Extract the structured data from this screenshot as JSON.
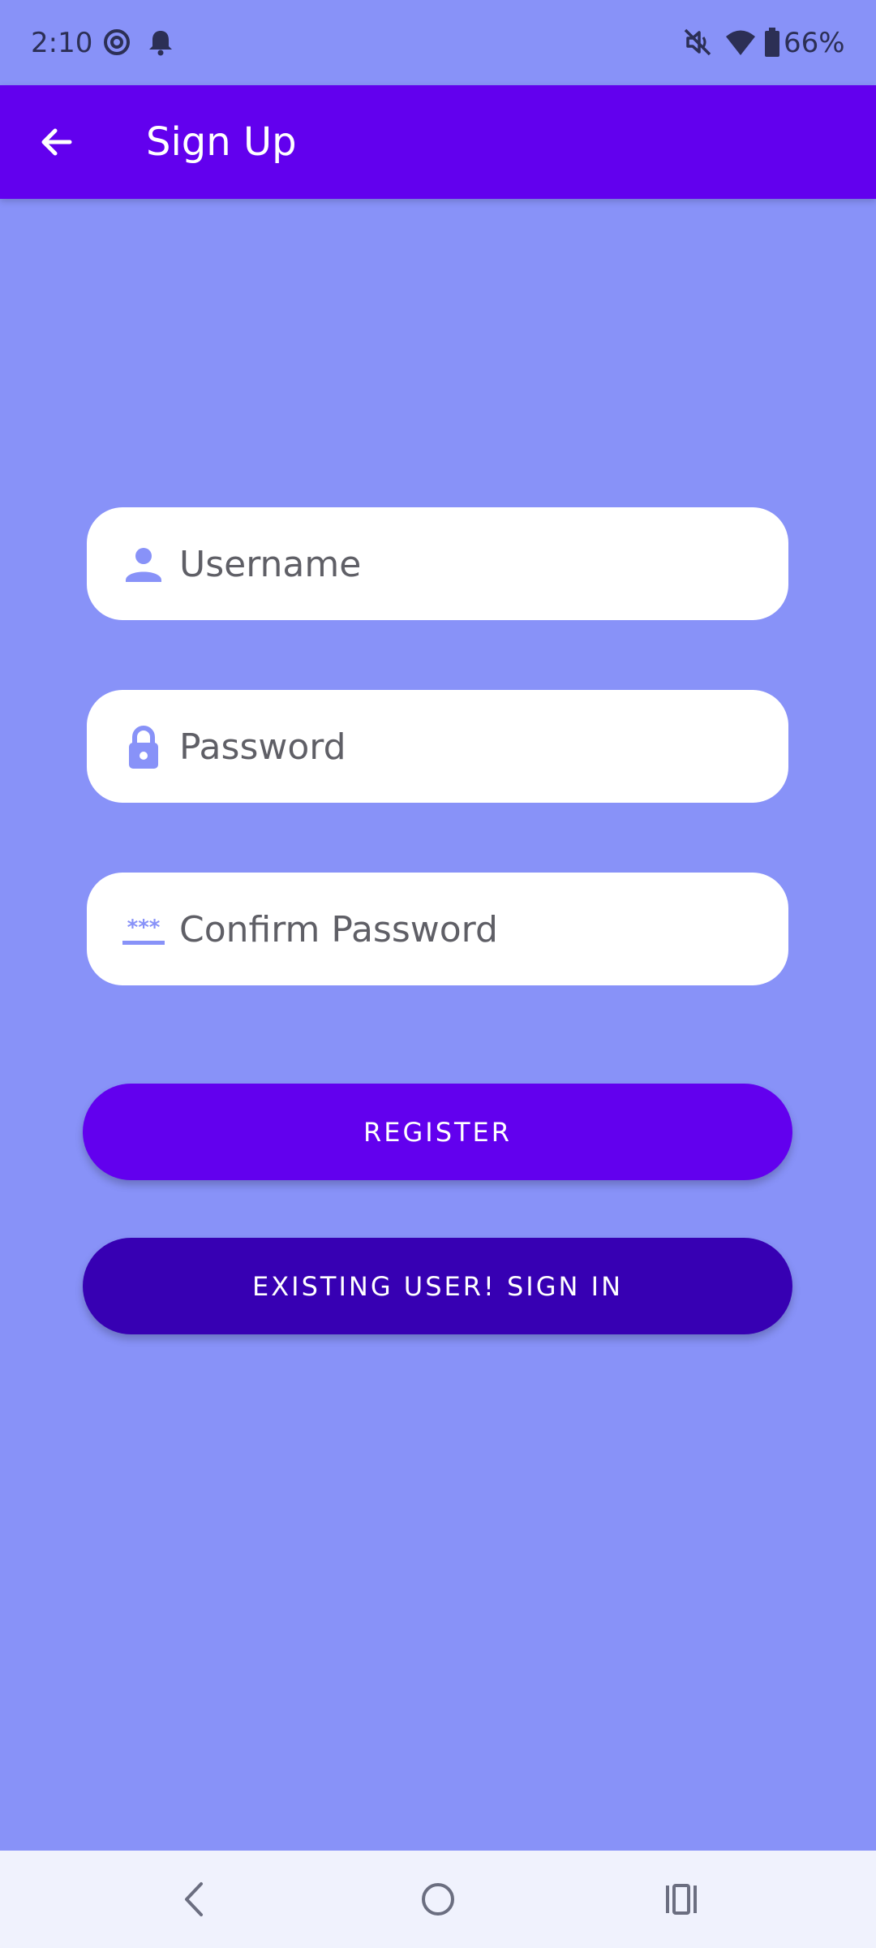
{
  "status_bar": {
    "time": "2:10",
    "battery": "66%",
    "icons": [
      "settings-icon",
      "notification-bell-icon",
      "mute-icon",
      "wifi-icon",
      "battery-icon"
    ]
  },
  "app_bar": {
    "title": "Sign Up",
    "back_icon": "arrow-back-icon"
  },
  "form": {
    "username": {
      "placeholder": "Username",
      "value": "",
      "icon": "person-icon"
    },
    "password": {
      "placeholder": "Password",
      "value": "",
      "icon": "lock-icon"
    },
    "confirm_password": {
      "placeholder": "Confirm Password",
      "value": "",
      "icon": "password-dots-icon"
    }
  },
  "buttons": {
    "register": "REGISTER",
    "sign_in": "EXISTING USER! SIGN IN"
  },
  "nav_bar": {
    "icons": [
      "nav-back-icon",
      "nav-home-icon",
      "nav-recents-icon"
    ]
  },
  "colors": {
    "background": "#8892f8",
    "primary": "#6200ee",
    "primary_dark": "#3700b3",
    "field_icon": "#8892f8",
    "text_on_primary": "#ffffff",
    "field_text": "#5f5f66"
  }
}
